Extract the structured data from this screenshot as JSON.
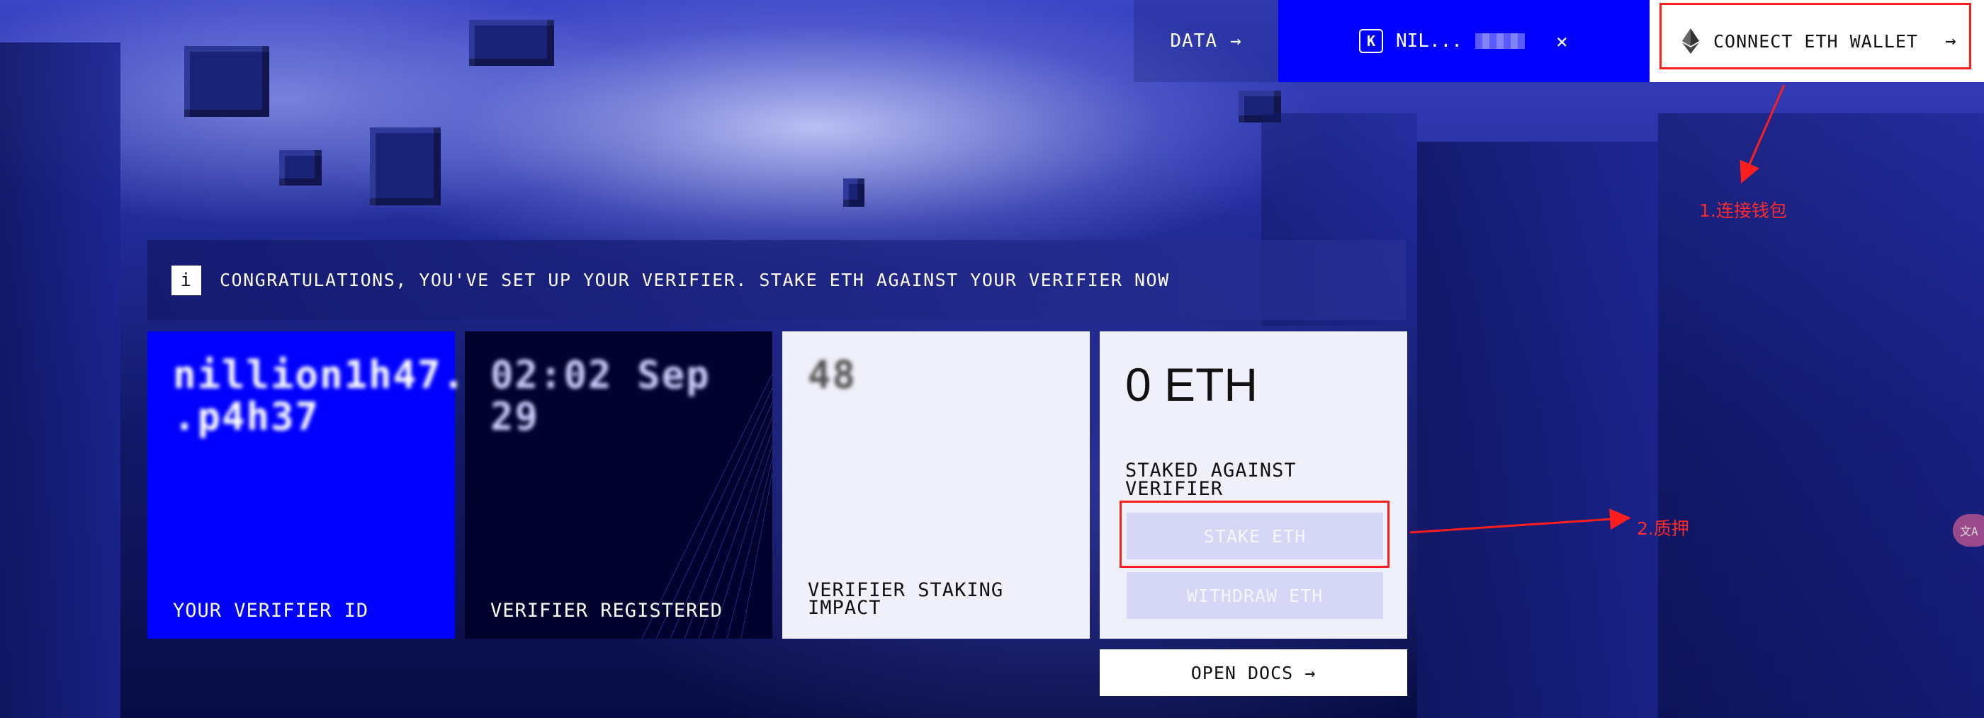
{
  "header": {
    "data_link": "DATA",
    "data_arrow": "→",
    "account_badge": "K",
    "account_name": "NIL...",
    "close_glyph": "×",
    "connect_label": "CONNECT ETH WALLET",
    "connect_arrow": "→"
  },
  "annotations": {
    "step1": "1.连接钱包",
    "step2": "2.质押"
  },
  "banner": {
    "icon_glyph": "i",
    "message": "CONGRATULATIONS, YOU'VE SET UP YOUR VERIFIER. STAKE ETH AGAINST YOUR VERIFIER NOW"
  },
  "cards": {
    "verifier_id": {
      "value": "nillion1h47...\n.p4h37",
      "label": "YOUR VERIFIER ID"
    },
    "registered": {
      "value": "02:02 Sep\n29",
      "label": "VERIFIER REGISTERED"
    },
    "impact": {
      "value": "48",
      "label": "VERIFIER STAKING\nIMPACT"
    },
    "stake": {
      "value": "0 ETH",
      "label": "STAKED AGAINST\nVERIFIER",
      "stake_button": "STAKE ETH",
      "withdraw_button": "WITHDRAW ETH"
    }
  },
  "docs": {
    "label": "OPEN DOCS",
    "arrow": "→"
  },
  "lang_toggle": "文A",
  "colors": {
    "accent_blue": "#0000ff",
    "dark_navy": "#02022e",
    "card_light": "#f0f0fb",
    "annotation_red": "#ff1e1e"
  }
}
